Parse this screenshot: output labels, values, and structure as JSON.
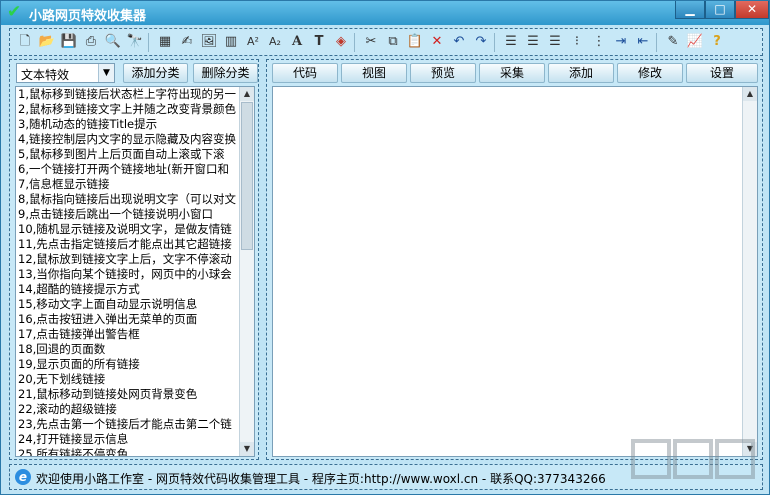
{
  "window": {
    "title": "小路网页特效收集器"
  },
  "category": {
    "selected": "文本特效",
    "add_label": "添加分类",
    "delete_label": "删除分类"
  },
  "tabs": [
    "代码",
    "视图",
    "预览",
    "采集",
    "添加",
    "修改",
    "设置"
  ],
  "list": [
    "1,鼠标移到链接后状态栏上字符出现的另一",
    "2,鼠标移到链接文字上并随之改变背景颜色",
    "3,随机动态的链接Title提示",
    "4,链接控制层内文字的显示隐藏及内容变换",
    "5,鼠标移到图片上后页面自动上滚或下滚",
    "6,一个链接打开两个链接地址(新开窗口和",
    "7,信息框显示链接",
    "8,鼠标指向链接后出现说明文字（可以对文",
    "9,点击链接后跳出一个链接说明小窗口",
    "10,随机显示链接及说明文字，是做友情链",
    "11,先点击指定链接后才能点出其它超链接",
    "12,鼠标放到链接文字上后，文字不停滚动",
    "13,当你指向某个链接时，网页中的小球会",
    "14,超酷的链接提示方式",
    "15,移动文字上面自动显示说明信息",
    "16,点击按钮进入弹出无菜单的页面",
    "17,点击链接弹出警告框",
    "18,回退的页面数",
    "19,显示页面的所有链接",
    "20,无下划线链接",
    "21,鼠标移动到链接处网页背景变色",
    "22,滚动的超级链接",
    "23,先点击第一个链接后才能点击第二个链",
    "24,打开链接显示信息",
    "25,所有链接不停变色"
  ],
  "status": {
    "text": "欢迎使用小路工作室 - 网页特效代码收集管理工具 - 程序主页:http://www.woxl.cn - 联系QQ:377343266"
  },
  "colors": {
    "window_bg": "#bfe4f5",
    "title_bar": "#2f97cc",
    "close_button": "#c23a2c"
  }
}
